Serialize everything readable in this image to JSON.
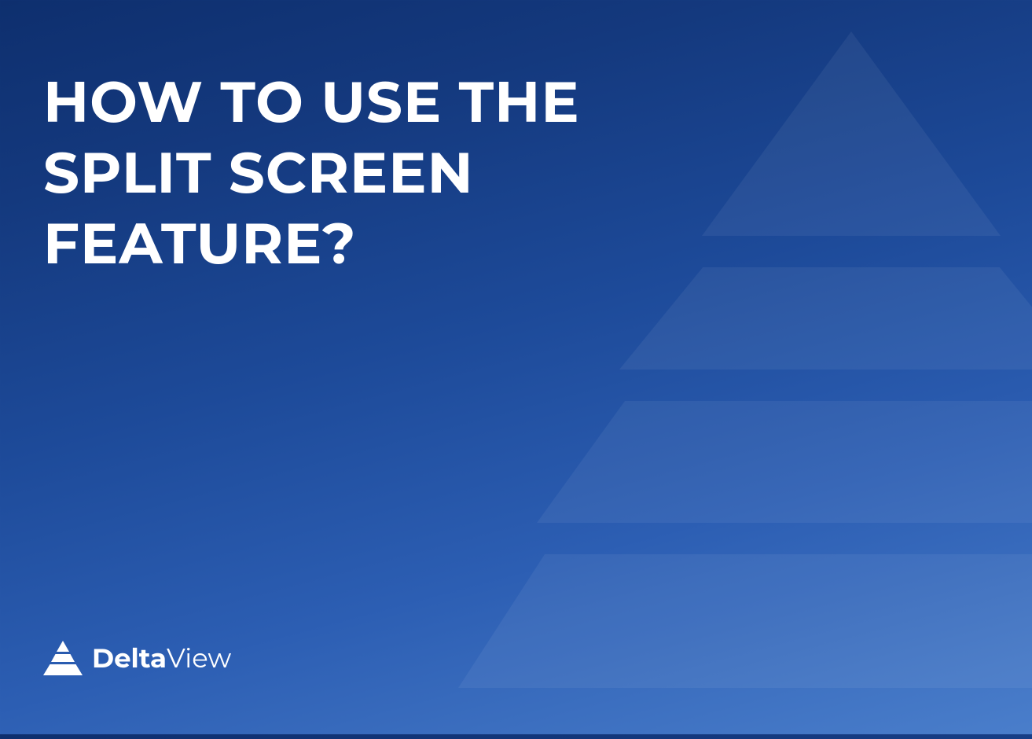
{
  "headline": "HOW TO USE THE SPLIT SCREEN FEATURE?",
  "brand": {
    "name_bold": "Delta",
    "name_light": "View"
  }
}
